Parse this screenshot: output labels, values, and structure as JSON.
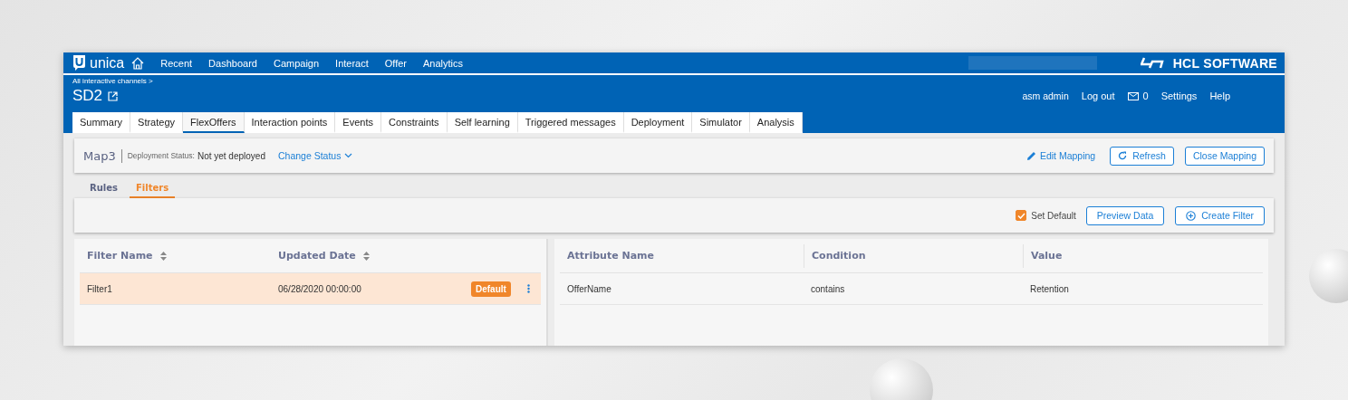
{
  "topbar": {
    "product": "unica",
    "nav": [
      "Recent",
      "Dashboard",
      "Campaign",
      "Interact",
      "Offer",
      "Analytics"
    ],
    "brand": "HCL SOFTWARE"
  },
  "header": {
    "breadcrumb": "All interactive channels >",
    "title": "SD2",
    "user": "asm admin",
    "logout": "Log out",
    "messages": "0",
    "settings": "Settings",
    "help": "Help"
  },
  "tabs": [
    {
      "label": "Summary",
      "selected": false
    },
    {
      "label": "Strategy",
      "selected": false
    },
    {
      "label": "FlexOffers",
      "selected": true
    },
    {
      "label": "Interaction points",
      "selected": false
    },
    {
      "label": "Events",
      "selected": false
    },
    {
      "label": "Constraints",
      "selected": false
    },
    {
      "label": "Self learning",
      "selected": false
    },
    {
      "label": "Triggered messages",
      "selected": false
    },
    {
      "label": "Deployment",
      "selected": false
    },
    {
      "label": "Simulator",
      "selected": false
    },
    {
      "label": "Analysis",
      "selected": false
    }
  ],
  "mapping": {
    "name": "Map3",
    "status_label": "Deployment Status:",
    "status": "Not yet deployed",
    "change_status": "Change Status",
    "edit": "Edit Mapping",
    "refresh": "Refresh",
    "close": "Close Mapping"
  },
  "subtabs": [
    {
      "label": "Rules",
      "selected": false
    },
    {
      "label": "Filters",
      "selected": true
    }
  ],
  "toolbar": {
    "set_default": {
      "label": "Set Default",
      "checked": true
    },
    "preview": "Preview Data",
    "create": "Create Filter"
  },
  "filters": {
    "columns": [
      "Filter Name",
      "Updated Date"
    ],
    "rows": [
      {
        "name": "Filter1",
        "date": "06/28/2020 00:00:00",
        "badge": "Default",
        "selected": true
      }
    ]
  },
  "attributes": {
    "columns": [
      "Attribute Name",
      "Condition",
      "Value"
    ],
    "rows": [
      {
        "attribute": "OfferName",
        "condition": "contains",
        "value": "Retention"
      }
    ]
  }
}
